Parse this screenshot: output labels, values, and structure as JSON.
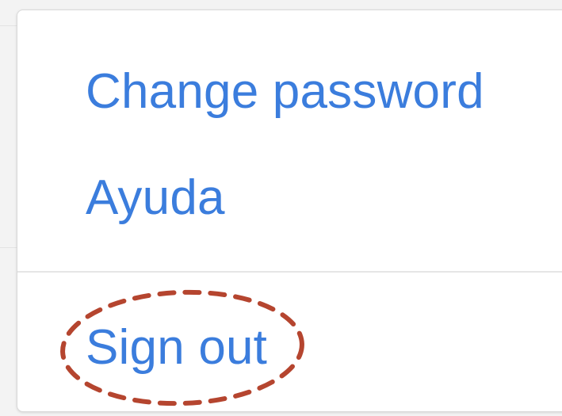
{
  "menu": {
    "items": [
      {
        "label": "Change password"
      },
      {
        "label": "Ayuda"
      },
      {
        "label": "Sign out"
      }
    ]
  },
  "colors": {
    "link": "#3b7ddd",
    "annotation": "#b5452f"
  },
  "annotation": {
    "shape": "dashed-ellipse",
    "target": "Sign out"
  }
}
